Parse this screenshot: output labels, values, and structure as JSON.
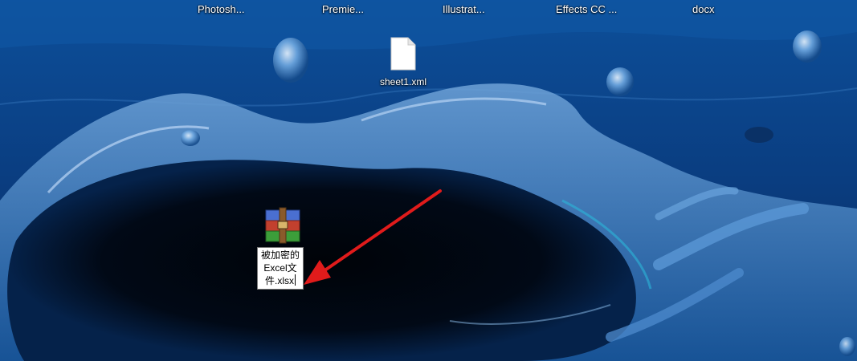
{
  "desktop": {
    "top_labels": [
      {
        "name": "photoshop-shortcut",
        "label": "Photosh..."
      },
      {
        "name": "premiere-shortcut",
        "label": "Premie..."
      },
      {
        "name": "illustrator-shortcut",
        "label": "Illustrat..."
      },
      {
        "name": "after-effects-shortcut",
        "label": "Effects CC ..."
      },
      {
        "name": "docx-shortcut",
        "label": "docx"
      }
    ],
    "xml_file": {
      "label": "sheet1.xml",
      "icon": "blank-file-icon"
    },
    "archive_file": {
      "icon": "winrar-archive-icon",
      "rename_lines": [
        "被加密的",
        "Excel文",
        "件.xlsx"
      ]
    },
    "annotation": {
      "icon": "red-arrow-icon",
      "color": "#e01b1b"
    }
  }
}
